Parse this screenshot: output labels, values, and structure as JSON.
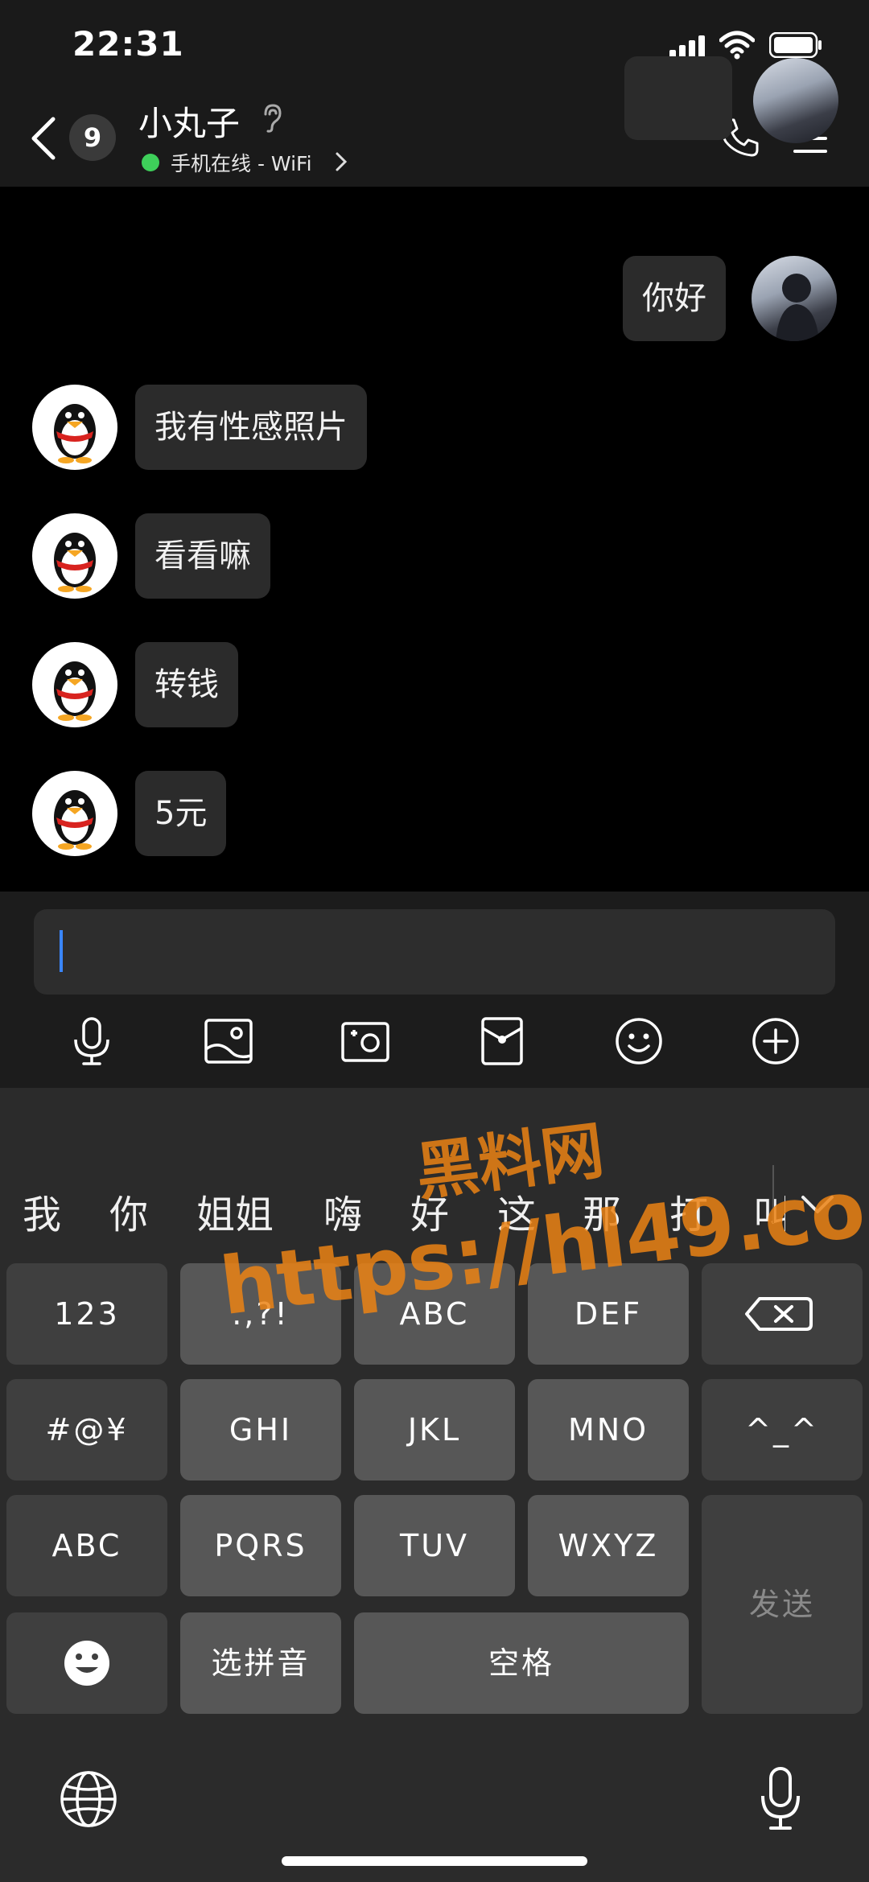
{
  "status_bar": {
    "time": "22:31",
    "icons": [
      "cellular-signal-icon",
      "wifi-icon",
      "battery-icon"
    ]
  },
  "header": {
    "back_icon": "chevron-left-icon",
    "unread_count": "9",
    "contact_name": "小丸子",
    "ear_icon": "ear-icon",
    "online_status": "手机在线 - WiFi",
    "online_color": "#3ecf5a",
    "actions": [
      "phone-icon",
      "menu-icon"
    ]
  },
  "messages": [
    {
      "sender": "me",
      "text": "你好"
    },
    {
      "sender": "contact",
      "text": "我有性感照片"
    },
    {
      "sender": "contact",
      "text": "看看嘛"
    },
    {
      "sender": "contact",
      "text": "转钱"
    },
    {
      "sender": "contact",
      "text": "5元"
    }
  ],
  "input": {
    "value": "",
    "cursor_color": "#3a86ff"
  },
  "toolbar": [
    "microphone-icon",
    "image-icon",
    "camera-icon",
    "red-envelope-icon",
    "emoji-icon",
    "plus-icon"
  ],
  "keyboard": {
    "candidates": [
      "我",
      "你",
      "姐姐",
      "嗨",
      "好",
      "这",
      "那",
      "打",
      "叫"
    ],
    "rows": [
      [
        "123",
        ".,?!",
        "ABC",
        "DEF"
      ],
      [
        "#@¥",
        "GHI",
        "JKL",
        "MNO",
        "^_^"
      ],
      [
        "ABC",
        "PQRS",
        "TUV",
        "WXYZ"
      ],
      [
        "选拼音",
        "空格"
      ]
    ],
    "send_label": "发送",
    "bottom_icons": [
      "globe-icon",
      "microphone-icon"
    ]
  },
  "watermark": {
    "title": "黑料网",
    "url": "https://hl49.co",
    "color": "#eb8214"
  }
}
